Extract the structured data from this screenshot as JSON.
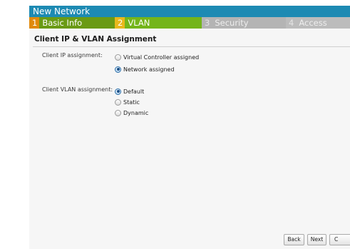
{
  "window": {
    "title": "New Network"
  },
  "steps": [
    {
      "num": "1",
      "label": "Basic Info"
    },
    {
      "num": "2",
      "label": "VLAN"
    },
    {
      "num": "3",
      "label": "Security"
    },
    {
      "num": "4",
      "label": "Access"
    }
  ],
  "section": {
    "title": "Client IP & VLAN Assignment"
  },
  "ip_assignment": {
    "label": "Client IP assignment:",
    "options": [
      {
        "label": "Virtual Controller assigned",
        "selected": false
      },
      {
        "label": "Network assigned",
        "selected": true
      }
    ]
  },
  "vlan_assignment": {
    "label": "Client VLAN assignment:",
    "options": [
      {
        "label": "Default",
        "selected": true
      },
      {
        "label": "Static",
        "selected": false
      },
      {
        "label": "Dynamic",
        "selected": false
      }
    ]
  },
  "buttons": {
    "back": "Back",
    "next": "Next",
    "cancel_partial": "C"
  },
  "colors": {
    "title_bar": "#1d8ab3",
    "step_active": "#74b51a",
    "step_done": "#6a9a14",
    "step_inactive": "#b4b4b4"
  }
}
